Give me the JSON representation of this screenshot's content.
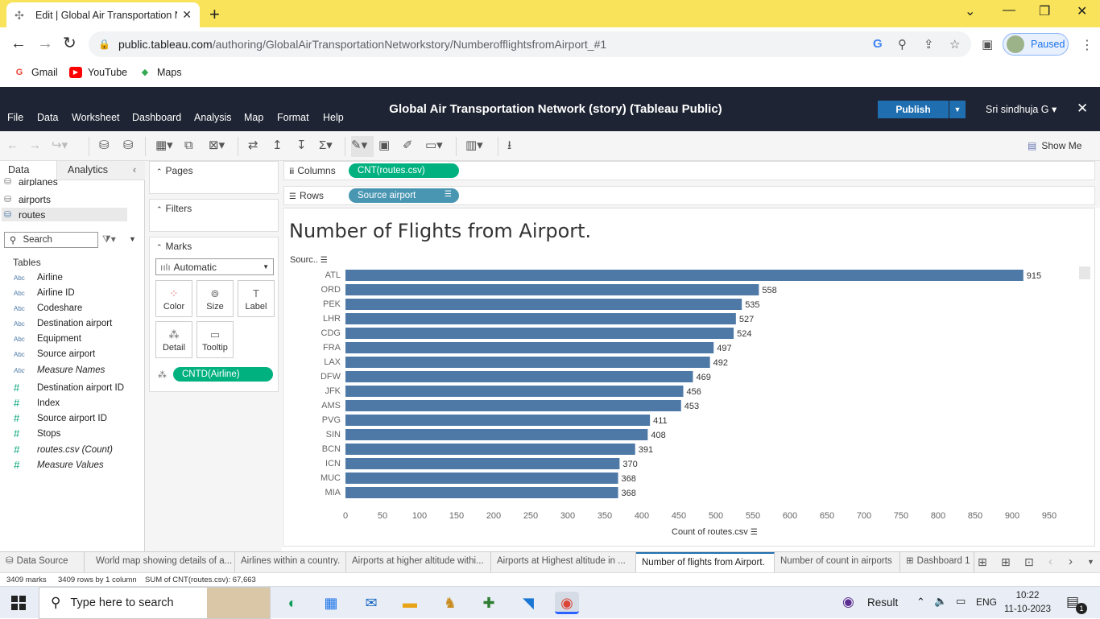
{
  "browser": {
    "tab_title": "Edit | Global Air Transportation Network",
    "url_host": "public.tableau.com",
    "url_path": "/authoring/GlobalAirTransportationNetworkstory/NumberofflightsfromAirport_#1",
    "profile_status": "Paused",
    "bookmarks": [
      "Gmail",
      "YouTube",
      "Maps"
    ]
  },
  "app": {
    "menu": [
      "File",
      "Data",
      "Worksheet",
      "Dashboard",
      "Analysis",
      "Map",
      "Format",
      "Help"
    ],
    "title": "Global Air Transportation Network (story) (Tableau Public)",
    "publish_label": "Publish",
    "user_name": "Sri sindhuja G",
    "show_me_label": "Show Me"
  },
  "data_pane": {
    "tab_data": "Data",
    "tab_analytics": "Analytics",
    "datasources": [
      "airplanes",
      "airports",
      "routes"
    ],
    "search_placeholder": "Search",
    "tables_heading": "Tables",
    "dimension_badge": "Abc",
    "measure_badge": "#",
    "dimensions": [
      "Airline",
      "Airline ID",
      "Codeshare",
      "Destination airport",
      "Equipment",
      "Source airport",
      "Measure Names"
    ],
    "measures": [
      "Destination airport ID",
      "Index",
      "Source airport ID",
      "Stops",
      "routes.csv (Count)",
      "Measure Values"
    ]
  },
  "cards": {
    "pages_label": "Pages",
    "filters_label": "Filters",
    "marks_label": "Marks",
    "mark_type": "Automatic",
    "buttons": [
      "Color",
      "Size",
      "Label",
      "Detail",
      "Tooltip"
    ],
    "detail_pill": "CNTD(Airline)"
  },
  "shelves": {
    "columns_label": "Columns",
    "columns_pill": "CNT(routes.csv)",
    "rows_label": "Rows",
    "rows_pill": "Source airport"
  },
  "sheet": {
    "title": "Number of Flights from Airport.",
    "row_header": "Sourc..",
    "x_axis_title": "Count of routes.csv"
  },
  "chart_data": {
    "type": "bar",
    "orientation": "horizontal",
    "title": "Number of Flights from Airport.",
    "xlabel": "Count of routes.csv",
    "ylabel": "Sourc..",
    "categories": [
      "ATL",
      "ORD",
      "PEK",
      "LHR",
      "CDG",
      "FRA",
      "LAX",
      "DFW",
      "JFK",
      "AMS",
      "PVG",
      "SIN",
      "BCN",
      "ICN",
      "MUC",
      "MIA"
    ],
    "values": [
      915,
      558,
      535,
      527,
      524,
      497,
      492,
      469,
      456,
      453,
      411,
      408,
      391,
      370,
      368,
      368
    ],
    "xlim": [
      0,
      950
    ],
    "xticks": [
      0,
      50,
      100,
      150,
      200,
      250,
      300,
      350,
      400,
      450,
      500,
      550,
      600,
      650,
      700,
      750,
      800,
      850,
      900,
      950
    ],
    "bar_color": "#4e79a7",
    "grid": false
  },
  "sheet_tabs": {
    "data_source": "Data Source",
    "tabs": [
      "World map showing details of a...",
      "Airlines within a country.",
      "Airports at higher altitude withi...",
      "Airports at Highest altitude in ...",
      "Number of flights from Airport.",
      "Number of count in airports",
      "Dashboard 1"
    ]
  },
  "status": {
    "marks": "3409 marks",
    "rows": "3409 rows by 1 column",
    "sum": "SUM of CNT(routes.csv): 67,663"
  },
  "taskbar": {
    "search_placeholder": "Type here to search",
    "weather_label": "Result",
    "language": "ENG",
    "time": "10:22",
    "date": "11-10-2023",
    "notification_count": "1"
  },
  "colors": {
    "brand_dark": "#1e2433",
    "publish": "#1f6fb0",
    "measure_pill": "#00b180",
    "dimension_pill": "#4996b2",
    "bar": "#4e79a7"
  }
}
